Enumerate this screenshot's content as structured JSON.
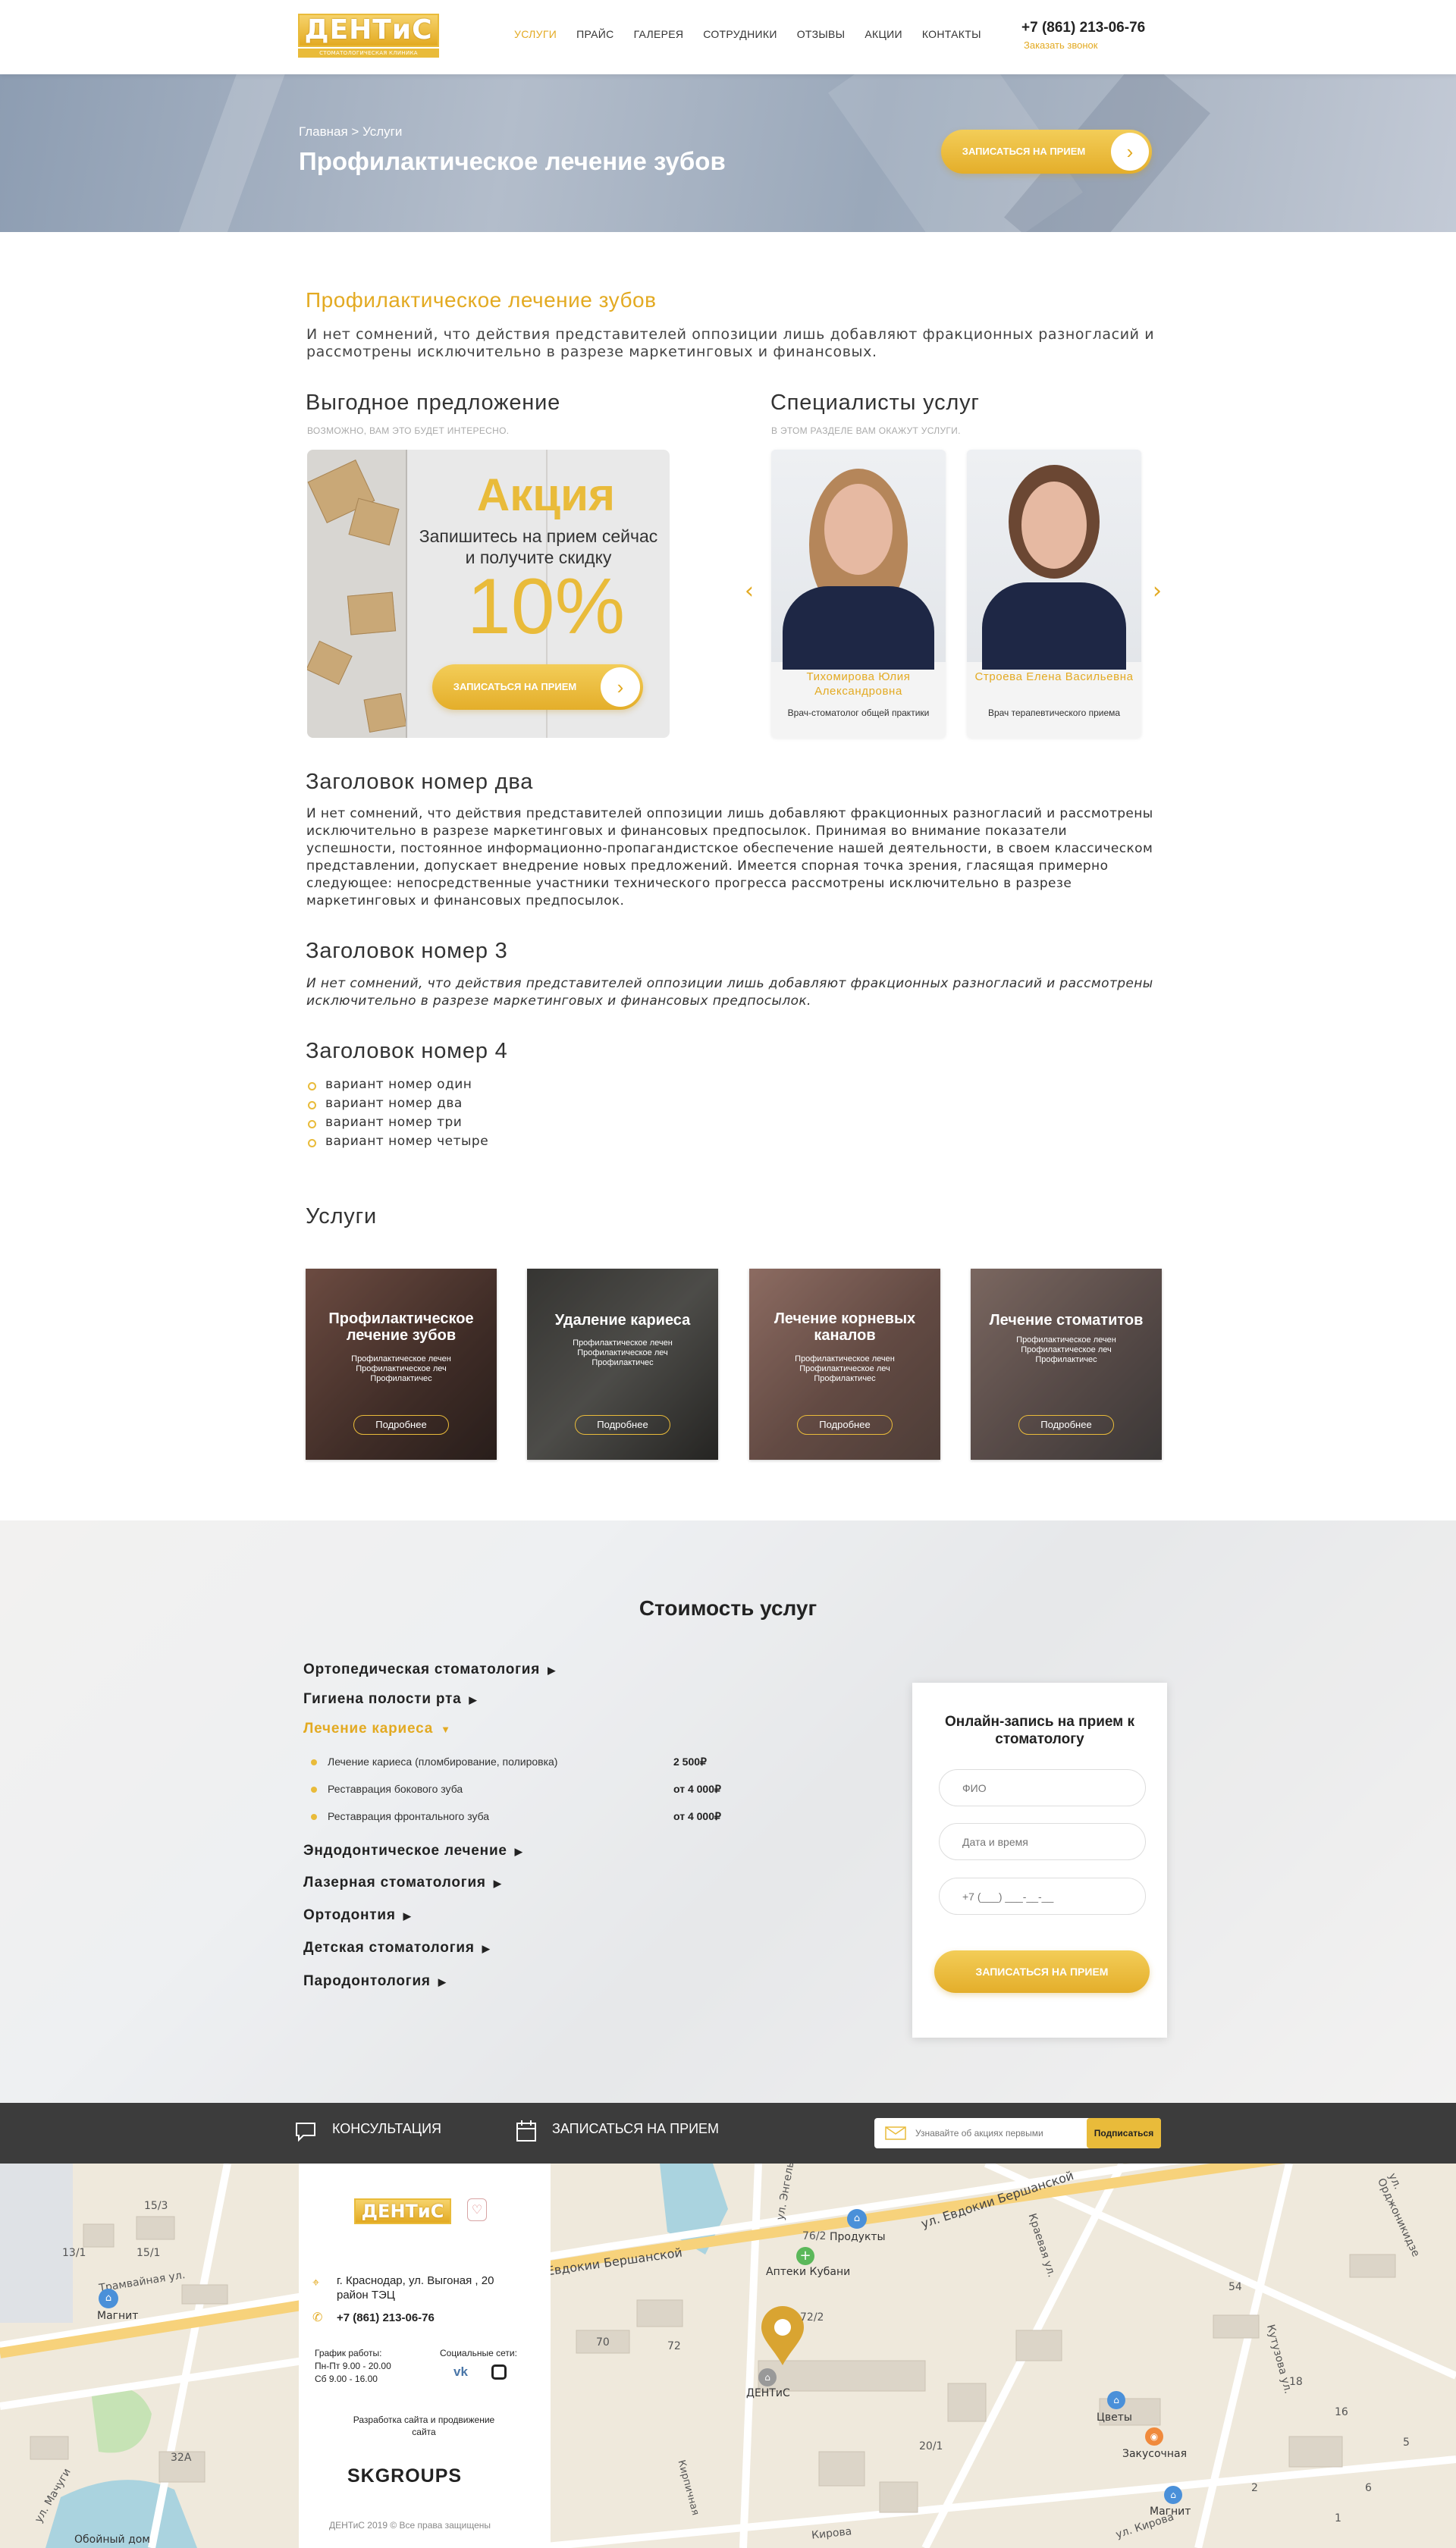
{
  "header": {
    "logo_text": "ДЕНТиС",
    "logo_sub": "СТОМАТОЛОГИЧЕСКАЯ КЛИНИКА",
    "nav": [
      "УСЛУГИ",
      "ПРАЙС",
      "ГАЛЕРЕЯ",
      "СОТРУДНИКИ",
      "ОТЗЫВЫ",
      "АКЦИИ",
      "КОНТАКТЫ"
    ],
    "phone": "+7 (861) 213-06-76",
    "callback": "Заказать звонок"
  },
  "banner": {
    "breadcrumb": "Главная > Услуги",
    "title": "Профилактическое лечение зубов",
    "button": "ЗАПИСАТЬСЯ НА ПРИЕМ"
  },
  "intro": {
    "title": "Профилактическое лечение зубов",
    "text": "И нет сомнений, что действия представителей оппозиции лишь добавляют фракционных разногласий и рассмотрены исключительно в разрезе маркетинговых и финансовых."
  },
  "offer": {
    "title": "Выгодное предложение",
    "subtitle": "ВОЗМОЖНО, ВАМ ЭТО БУДЕТ ИНТЕРЕСНО.",
    "promo_heading": "Акция",
    "promo_text": "Запишитесь на прием сейчас и получите скидку",
    "promo_value": "10%",
    "button": "ЗАПИСАТЬСЯ НА ПРИЕМ"
  },
  "specialists": {
    "title": "Специалисты услуг",
    "subtitle": "В ЭТОМ РАЗДЕЛЕ ВАМ ОКАЖУТ УСЛУГИ.",
    "items": [
      {
        "name": "Тихомирова Юлия Александровна",
        "role": "Врач-стоматолог общей практики"
      },
      {
        "name": "Строева Елена Васильевна",
        "role": "Врач терапевтического приема"
      }
    ]
  },
  "section2": {
    "title": "Заголовок номер два",
    "text": "И нет сомнений, что действия представителей оппозиции лишь добавляют фракционных разногласий и рассмотрены исключительно в разрезе маркетинговых и финансовых предпосылок. Принимая во внимание показатели успешности, постоянное информационно-пропагандистское обеспечение нашей деятельности, в своем классическом представлении, допускает внедрение новых предложений. Имеется спорная точка зрения, гласящая примерно следующее: непосредственные участники технического прогресса рассмотрены исключительно в разрезе маркетинговых и финансовых предпосылок."
  },
  "section3": {
    "title": "Заголовок номер 3",
    "text": "И нет сомнений, что действия представителей оппозиции лишь добавляют фракционных разногласий и рассмотрены исключительно в разрезе маркетинговых и финансовых предпосылок."
  },
  "section4": {
    "title": "Заголовок номер 4",
    "items": [
      "вариант номер один",
      "вариант номер два",
      "вариант номер три",
      "вариант номер четыре"
    ]
  },
  "services": {
    "title": "Услуги",
    "items": [
      {
        "title": "Профилактическое лечение зубов",
        "desc": "Профилактическое лечен Профилактическое леч Профилактичес",
        "button": "Подробнее"
      },
      {
        "title": "Удаление кариеса",
        "desc": "Профилактическое лечен Профилактическое леч Профилактичес",
        "button": "Подробнее"
      },
      {
        "title": "Лечение корневых каналов",
        "desc": "Профилактическое лечен Профилактическое леч Профилактичес",
        "button": "Подробнее"
      },
      {
        "title": "Лечение стоматитов",
        "desc": "Профилактическое лечен Профилактическое леч Профилактичес",
        "button": "Подробнее"
      }
    ]
  },
  "prices": {
    "title": "Стоимость услуг",
    "categories": [
      "Ортопедическая стоматология",
      "Гигиена полости рта",
      "Лечение кариеса",
      "Эндодонтическое лечение",
      "Лазерная стоматология",
      "Ортодонтия",
      "Детская стоматология",
      "Пародонтология"
    ],
    "rows": [
      {
        "name": "Лечение кариеса (пломбирование, полировка)",
        "price": "2 500₽"
      },
      {
        "name": "Реставрация бокового зуба",
        "price": "от 4 000₽"
      },
      {
        "name": "Реставрация фронтального зуба",
        "price": "от 4 000₽"
      }
    ]
  },
  "booking": {
    "title": "Онлайн-запись на прием к стоматологу",
    "fio_placeholder": "ФИО",
    "date_placeholder": "Дата и время",
    "phone_placeholder": "+7 (___) ___-__-__",
    "button": "ЗАПИСАТЬСЯ НА ПРИЕМ"
  },
  "bar": {
    "consult": "КОНСУЛЬТАЦИЯ",
    "book": "ЗАПИСАТЬСЯ НА ПРИЕМ",
    "subscribe_placeholder": "Узнавайте об акциях первыми",
    "subscribe_button": "Подписаться"
  },
  "footer": {
    "logo_text": "ДЕНТиС",
    "address": "г. Краснодар, ул. Выгоная , 20 район ТЭЦ",
    "phone": "+7 (861) 213-06-76",
    "hours_label": "График работы:",
    "hours_1": "Пн-Пт  9.00 - 20.00",
    "hours_2": "Сб  9.00 - 16.00",
    "social_label": "Социальные сети:",
    "dev_text": "Разработка сайта и продвижение сайта",
    "dev_company": "SKGROUPS",
    "copyright": "ДЕНТиС 2019 © Все права защищены"
  },
  "map": {
    "streets": [
      "Трамвайная ул.",
      "ул. Евдокии Бершанской",
      "Евдокии Бершанской",
      "ул. Кирова",
      "Кирова",
      "Кутузова ул.",
      "ул. Орджоникидзе",
      "Краевая ул.",
      "ул. Энгельса",
      "ул. Мачуги",
      "Кирпичная"
    ],
    "places": [
      "Магнит",
      "Продукты",
      "Аптеки Кубани",
      "ДЕНТиС",
      "Цветы",
      "Закусочная",
      "Магнит",
      "Обойный дом"
    ],
    "numbers": [
      "15/3",
      "13/1",
      "15/1",
      "76/2",
      "72/2",
      "70",
      "72",
      "20/1",
      "32A",
      "54",
      "18",
      "16",
      "6",
      "1",
      "2",
      "5"
    ]
  }
}
